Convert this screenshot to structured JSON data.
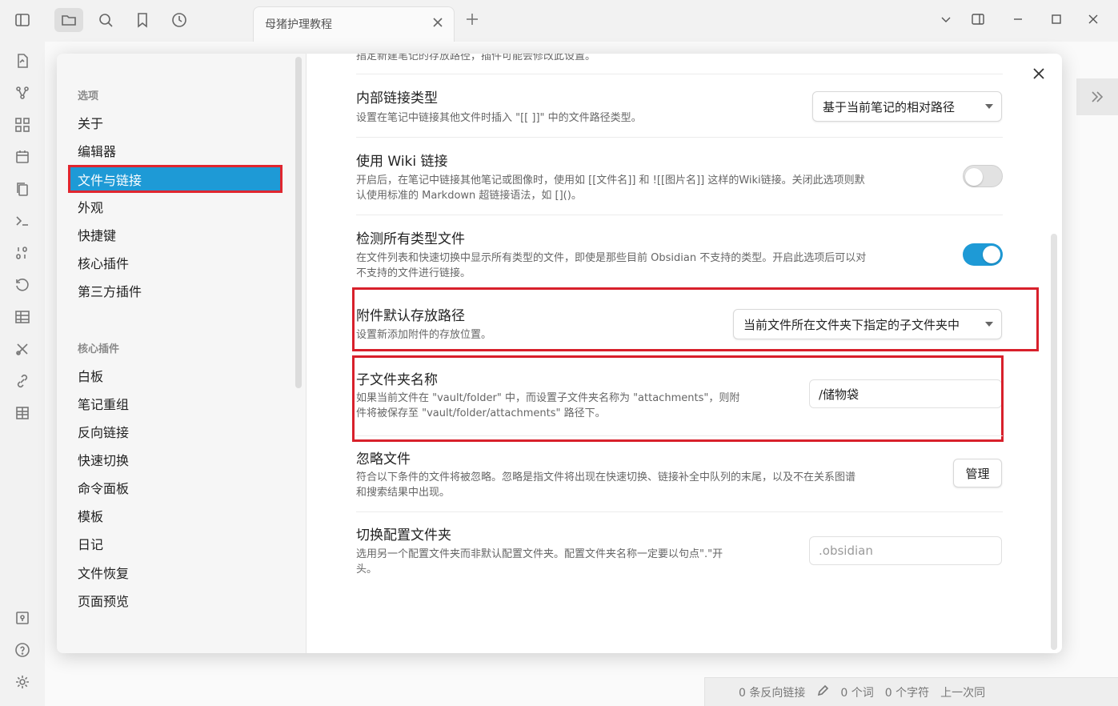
{
  "tab": {
    "title": "母猪护理教程"
  },
  "sidebar": {
    "options_heading": "选项",
    "options": [
      "关于",
      "编辑器",
      "文件与链接",
      "外观",
      "快捷键",
      "核心插件",
      "第三方插件"
    ],
    "active_index": 2,
    "core_heading": "核心插件",
    "core_plugins": [
      "白板",
      "笔记重组",
      "反向链接",
      "快速切换",
      "命令面板",
      "模板",
      "日记",
      "文件恢复",
      "页面预览"
    ]
  },
  "settings": {
    "top_cut_desc": "指定新建笔记的存放路径，插件可能会修改此设置。",
    "internal_link": {
      "name": "内部链接类型",
      "desc": "设置在笔记中链接其他文件时插入 \"[[ ]]\" 中的文件路径类型。",
      "value": "基于当前笔记的相对路径"
    },
    "wiki_link": {
      "name": "使用 Wiki 链接",
      "desc_line1": "开启后，在笔记中链接其他笔记或图像时，使用如 [[文件名]] 和 ![[图片名]] 这样的Wiki链接。关闭此选项则默",
      "desc_line2": "认使用标准的 Markdown 超链接语法，如 []()。"
    },
    "detect_all": {
      "name": "检测所有类型文件",
      "desc_line1": "在文件列表和快速切换中显示所有类型的文件，即使是那些目前 Obsidian 不支持的类型。开启此选项后可以对",
      "desc_line2": "不支持的文件进行链接。"
    },
    "attachment_path": {
      "name": "附件默认存放路径",
      "desc": "设置新添加附件的存放位置。",
      "value": "当前文件所在文件夹下指定的子文件夹中"
    },
    "subfolder": {
      "name": "子文件夹名称",
      "desc_line1": "如果当前文件在 \"vault/folder\" 中，而设置子文件夹名称为 \"attachments\"，则附",
      "desc_line2": "件将被保存至 \"vault/folder/attachments\" 路径下。",
      "value": "/储物袋"
    },
    "ignore_files": {
      "name": "忽略文件",
      "desc_line1": "符合以下条件的文件将被忽略。忽略是指文件将出现在快速切换、链接补全中队列的末尾，以及不在关系图谱",
      "desc_line2": "和搜索结果中出现。",
      "button": "管理"
    },
    "config_folder": {
      "name": "切换配置文件夹",
      "desc_line1": "选用另一个配置文件夹而非默认配置文件夹。配置文件夹名称一定要以句点\".\"开",
      "desc_line2": "头。",
      "placeholder": ".obsidian"
    }
  },
  "statusbar": {
    "backlinks": "0 条反向链接",
    "words": "0 个词",
    "chars": "0 个字符",
    "partial": "上一次同"
  }
}
